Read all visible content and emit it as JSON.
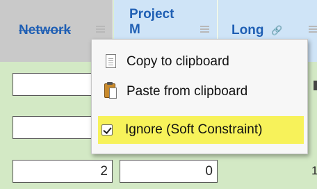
{
  "columns": {
    "network": "Network",
    "project": "Project M",
    "long": "Long"
  },
  "rows": [
    {
      "network": "",
      "project": ""
    },
    {
      "network": "",
      "project": ""
    },
    {
      "network": "2",
      "project": "0"
    }
  ],
  "edge_value": "1",
  "context_menu": {
    "copy": "Copy to clipboard",
    "paste": "Paste from clipboard",
    "ignore": "Ignore (Soft Constraint)",
    "ignore_checked": true
  },
  "colors": {
    "row_bg": "#d3e9c5",
    "header_active": "#cfe4f7",
    "header_struck": "#c9c9c9",
    "highlight": "#f7f25a",
    "header_text": "#1f5fb4"
  },
  "icons": [
    "sort-menu-icon",
    "link-icon",
    "copy-icon",
    "paste-icon",
    "checkbox-checked-icon"
  ]
}
